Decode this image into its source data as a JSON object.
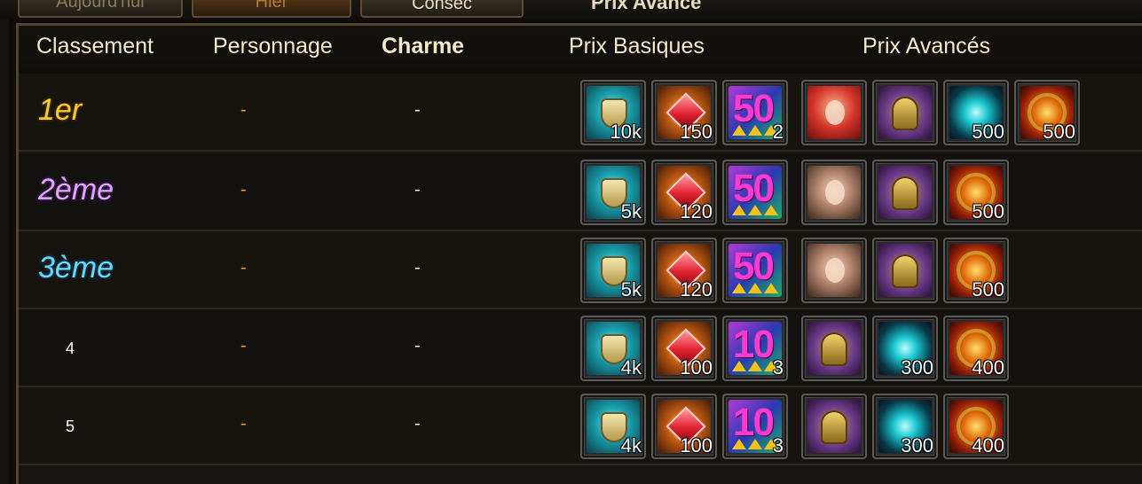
{
  "tabs": {
    "tab1": "Aujourd'hui",
    "tab2": "Hier",
    "tab3": "Consec",
    "title": "Prix Avancé"
  },
  "headers": {
    "rank": "Classement",
    "character": "Personnage",
    "charm": "Charme",
    "basic": "Prix Basiques",
    "advanced": "Prix Avancés"
  },
  "rows": [
    {
      "rank": "1er",
      "character": "-",
      "charm": "-",
      "basic": [
        {
          "icon": "shield-icon",
          "qty": "10k"
        },
        {
          "icon": "red-gem-icon",
          "qty": "150"
        },
        {
          "icon": "crystal-pack-icon",
          "big": "50",
          "qty": "2"
        }
      ],
      "advanced": [
        {
          "icon": "hero-portrait-red-icon",
          "qty": ""
        },
        {
          "icon": "golden-helm-icon",
          "qty": ""
        },
        {
          "icon": "cyan-orb-icon",
          "qty": "500"
        },
        {
          "icon": "fire-medal-icon",
          "qty": "500"
        }
      ]
    },
    {
      "rank": "2ème",
      "character": "-",
      "charm": "-",
      "basic": [
        {
          "icon": "shield-icon",
          "qty": "5k"
        },
        {
          "icon": "red-gem-icon",
          "qty": "120"
        },
        {
          "icon": "crystal-pack-icon",
          "big": "50",
          "qty": ""
        }
      ],
      "advanced": [
        {
          "icon": "hero-portrait-woman-icon",
          "qty": ""
        },
        {
          "icon": "golden-helm-icon",
          "qty": ""
        },
        {
          "icon": "fire-medal-icon",
          "qty": "500"
        }
      ]
    },
    {
      "rank": "3ème",
      "character": "-",
      "charm": "-",
      "basic": [
        {
          "icon": "shield-icon",
          "qty": "5k"
        },
        {
          "icon": "red-gem-icon",
          "qty": "120"
        },
        {
          "icon": "crystal-pack-icon",
          "big": "50",
          "qty": ""
        }
      ],
      "advanced": [
        {
          "icon": "hero-portrait-woman-icon",
          "qty": ""
        },
        {
          "icon": "golden-helm-icon",
          "qty": ""
        },
        {
          "icon": "fire-medal-icon",
          "qty": "500"
        }
      ]
    },
    {
      "rank": "4",
      "character": "-",
      "charm": "-",
      "basic": [
        {
          "icon": "shield-icon",
          "qty": "4k"
        },
        {
          "icon": "red-gem-icon",
          "qty": "100"
        },
        {
          "icon": "crystal-pack-icon",
          "big": "10",
          "qty": "3"
        }
      ],
      "advanced": [
        {
          "icon": "golden-helm-icon",
          "qty": ""
        },
        {
          "icon": "cyan-orb-icon",
          "qty": "300"
        },
        {
          "icon": "fire-medal-icon",
          "qty": "400"
        }
      ]
    },
    {
      "rank": "5",
      "character": "-",
      "charm": "-",
      "basic": [
        {
          "icon": "shield-icon",
          "qty": "4k"
        },
        {
          "icon": "red-gem-icon",
          "qty": "100"
        },
        {
          "icon": "crystal-pack-icon",
          "big": "10",
          "qty": "3"
        }
      ],
      "advanced": [
        {
          "icon": "golden-helm-icon",
          "qty": ""
        },
        {
          "icon": "cyan-orb-icon",
          "qty": "300"
        },
        {
          "icon": "fire-medal-icon",
          "qty": "400"
        }
      ]
    }
  ]
}
